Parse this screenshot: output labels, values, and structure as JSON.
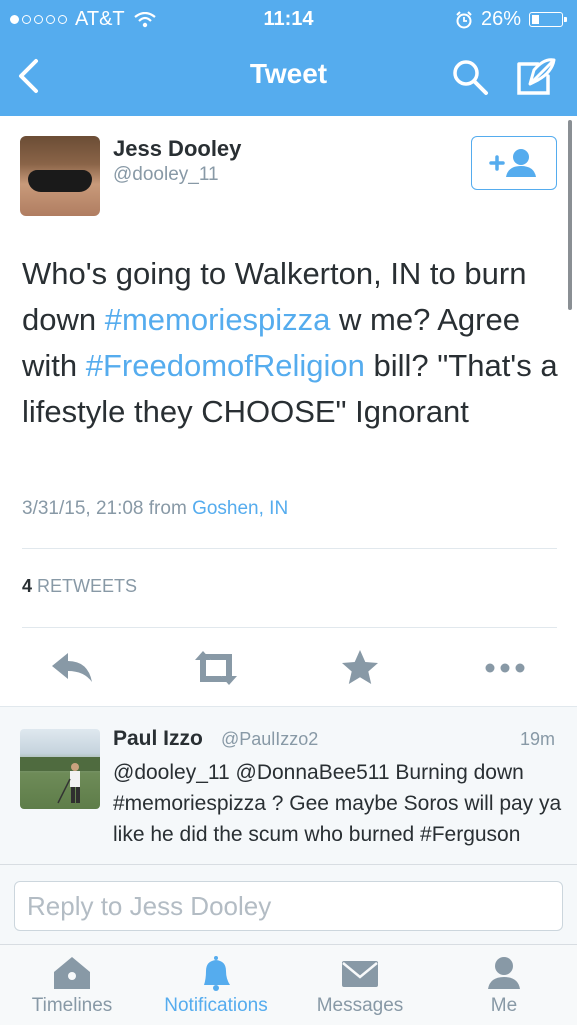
{
  "status_bar": {
    "carrier": "AT&T",
    "time": "11:14",
    "battery": "26%",
    "battery_level": 0.26
  },
  "nav": {
    "title": "Tweet",
    "back_icon": "chevron-left-icon",
    "search_icon": "search-icon",
    "compose_icon": "compose-icon"
  },
  "tweet": {
    "author_name": "Jess Dooley",
    "author_handle": "@dooley_11",
    "text_parts": {
      "p1": "Who's going to Walkerton, IN to burn down ",
      "tag1": "#memoriespizza",
      "p2": " w me? Agree with ",
      "tag2": "#FreedomofReligion",
      "p3": " bill? \"That's a lifestyle they CHOOSE\" Ignorant"
    },
    "timestamp": "3/31/15, 21:08 from",
    "location": "Goshen, IN",
    "retweet_count": "4",
    "retweet_label": "RETWEETS"
  },
  "actions": [
    "reply-icon",
    "retweet-icon",
    "favorite-icon",
    "more-icon"
  ],
  "reply": {
    "name": "Paul Izzo",
    "handle": "@PaulIzzo2",
    "time": "19m",
    "text": "@dooley_11 @DonnaBee511 Burning down #memoriespizza ?  Gee maybe Soros will pay ya like he did the scum who burned #Ferguson"
  },
  "composer": {
    "placeholder": "Reply to Jess Dooley"
  },
  "tabs": [
    {
      "label": "Timelines",
      "icon": "home-icon"
    },
    {
      "label": "Notifications",
      "icon": "bell-icon"
    },
    {
      "label": "Messages",
      "icon": "envelope-icon"
    },
    {
      "label": "Me",
      "icon": "person-icon"
    }
  ],
  "colors": {
    "brand": "#55acee",
    "text": "#292f33",
    "muted": "#8899a6"
  }
}
